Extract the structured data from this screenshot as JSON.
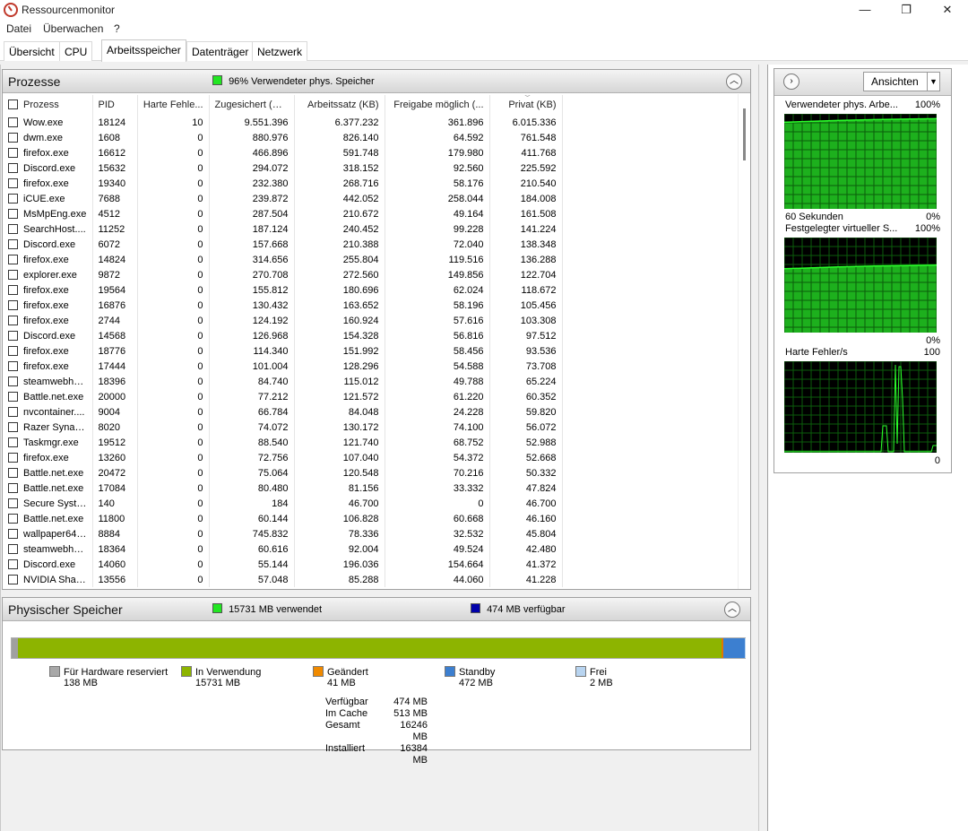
{
  "window": {
    "title": "Ressourcenmonitor",
    "min": "—",
    "max": "❐",
    "close": "✕"
  },
  "menu": [
    "Datei",
    "Überwachen",
    "?"
  ],
  "tabs": [
    {
      "label": "Übersicht"
    },
    {
      "label": "CPU"
    },
    {
      "label": "Arbeitsspeicher"
    },
    {
      "label": "Datenträger"
    },
    {
      "label": "Netzwerk"
    }
  ],
  "active_tab": "Arbeitsspeicher",
  "processes": {
    "title": "Prozesse",
    "status": "96% Verwendeter phys. Speicher",
    "status_color": "#22e622",
    "columns": [
      "Prozess",
      "PID",
      "Harte Fehle...",
      "Zugesichert (KB)",
      "Arbeitssatz (KB)",
      "Freigabe möglich (...",
      "Privat (KB)"
    ],
    "rows": [
      [
        "Wow.exe",
        "18124",
        "10",
        "9.551.396",
        "6.377.232",
        "361.896",
        "6.015.336"
      ],
      [
        "dwm.exe",
        "1608",
        "0",
        "880.976",
        "826.140",
        "64.592",
        "761.548"
      ],
      [
        "firefox.exe",
        "16612",
        "0",
        "466.896",
        "591.748",
        "179.980",
        "411.768"
      ],
      [
        "Discord.exe",
        "15632",
        "0",
        "294.072",
        "318.152",
        "92.560",
        "225.592"
      ],
      [
        "firefox.exe",
        "19340",
        "0",
        "232.380",
        "268.716",
        "58.176",
        "210.540"
      ],
      [
        "iCUE.exe",
        "7688",
        "0",
        "239.872",
        "442.052",
        "258.044",
        "184.008"
      ],
      [
        "MsMpEng.exe",
        "4512",
        "0",
        "287.504",
        "210.672",
        "49.164",
        "161.508"
      ],
      [
        "SearchHost....",
        "11252",
        "0",
        "187.124",
        "240.452",
        "99.228",
        "141.224"
      ],
      [
        "Discord.exe",
        "6072",
        "0",
        "157.668",
        "210.388",
        "72.040",
        "138.348"
      ],
      [
        "firefox.exe",
        "14824",
        "0",
        "314.656",
        "255.804",
        "119.516",
        "136.288"
      ],
      [
        "explorer.exe",
        "9872",
        "0",
        "270.708",
        "272.560",
        "149.856",
        "122.704"
      ],
      [
        "firefox.exe",
        "19564",
        "0",
        "155.812",
        "180.696",
        "62.024",
        "118.672"
      ],
      [
        "firefox.exe",
        "16876",
        "0",
        "130.432",
        "163.652",
        "58.196",
        "105.456"
      ],
      [
        "firefox.exe",
        "2744",
        "0",
        "124.192",
        "160.924",
        "57.616",
        "103.308"
      ],
      [
        "Discord.exe",
        "14568",
        "0",
        "126.968",
        "154.328",
        "56.816",
        "97.512"
      ],
      [
        "firefox.exe",
        "18776",
        "0",
        "114.340",
        "151.992",
        "58.456",
        "93.536"
      ],
      [
        "firefox.exe",
        "17444",
        "0",
        "101.004",
        "128.296",
        "54.588",
        "73.708"
      ],
      [
        "steamwebhe...",
        "18396",
        "0",
        "84.740",
        "115.012",
        "49.788",
        "65.224"
      ],
      [
        "Battle.net.exe",
        "20000",
        "0",
        "77.212",
        "121.572",
        "61.220",
        "60.352"
      ],
      [
        "nvcontainer....",
        "9004",
        "0",
        "66.784",
        "84.048",
        "24.228",
        "59.820"
      ],
      [
        "Razer Synap...",
        "8020",
        "0",
        "74.072",
        "130.172",
        "74.100",
        "56.072"
      ],
      [
        "Taskmgr.exe",
        "19512",
        "0",
        "88.540",
        "121.740",
        "68.752",
        "52.988"
      ],
      [
        "firefox.exe",
        "13260",
        "0",
        "72.756",
        "107.040",
        "54.372",
        "52.668"
      ],
      [
        "Battle.net.exe",
        "20472",
        "0",
        "75.064",
        "120.548",
        "70.216",
        "50.332"
      ],
      [
        "Battle.net.exe",
        "17084",
        "0",
        "80.480",
        "81.156",
        "33.332",
        "47.824"
      ],
      [
        "Secure System",
        "140",
        "0",
        "184",
        "46.700",
        "0",
        "46.700"
      ],
      [
        "Battle.net.exe",
        "11800",
        "0",
        "60.144",
        "106.828",
        "60.668",
        "46.160"
      ],
      [
        "wallpaper64....",
        "8884",
        "0",
        "745.832",
        "78.336",
        "32.532",
        "45.804"
      ],
      [
        "steamwebhe...",
        "18364",
        "0",
        "60.616",
        "92.004",
        "49.524",
        "42.480"
      ],
      [
        "Discord.exe",
        "14060",
        "0",
        "55.144",
        "196.036",
        "154.664",
        "41.372"
      ],
      [
        "NVIDIA Shar...",
        "13556",
        "0",
        "57.048",
        "85.288",
        "44.060",
        "41.228"
      ]
    ]
  },
  "physical": {
    "title": "Physischer Speicher",
    "used_label": "15731 MB verwendet",
    "used_color": "#22e622",
    "avail_label": "474 MB verfügbar",
    "avail_color": "#0000aa",
    "bar": [
      {
        "name": "hardware",
        "mb": 138,
        "color": "#a0a0a0"
      },
      {
        "name": "inuse",
        "mb": 15731,
        "color": "#8db400"
      },
      {
        "name": "modified",
        "mb": 41,
        "color": "#e07800"
      },
      {
        "name": "standby",
        "mb": 472,
        "color": "#3c7fd0"
      },
      {
        "name": "free",
        "mb": 2,
        "color": "#b8d4f0"
      }
    ],
    "legend": [
      {
        "label": "Für Hardware reserviert",
        "value": "138 MB",
        "color": "#a8a8a8"
      },
      {
        "label": "In Verwendung",
        "value": "15731 MB",
        "color": "#8db400"
      },
      {
        "label": "Geändert",
        "value": "41 MB",
        "color": "#f08a00"
      },
      {
        "label": "Standby",
        "value": "472 MB",
        "color": "#3c7fd0"
      },
      {
        "label": "Frei",
        "value": "2 MB",
        "color": "#b8d4f0"
      }
    ],
    "stats": [
      {
        "label": "Verfügbar",
        "value": "474 MB"
      },
      {
        "label": "Im Cache",
        "value": "513 MB"
      },
      {
        "label": "Gesamt",
        "value": "16246 MB"
      },
      {
        "label": "Installiert",
        "value": "16384 MB"
      }
    ]
  },
  "right": {
    "views_label": "Ansichten",
    "graphs": [
      {
        "title": "Verwendeter phys. Arbe...",
        "max": "100%",
        "min": "0%",
        "footer": "60 Sekunden",
        "kind": "memory",
        "level": 0.94
      },
      {
        "title": "Festgelegter virtueller S...",
        "max": "100%",
        "min": "0%",
        "kind": "commit",
        "level": 0.7
      },
      {
        "title": "Harte Fehler/s",
        "max": "100",
        "min": "0",
        "kind": "faults"
      }
    ]
  }
}
